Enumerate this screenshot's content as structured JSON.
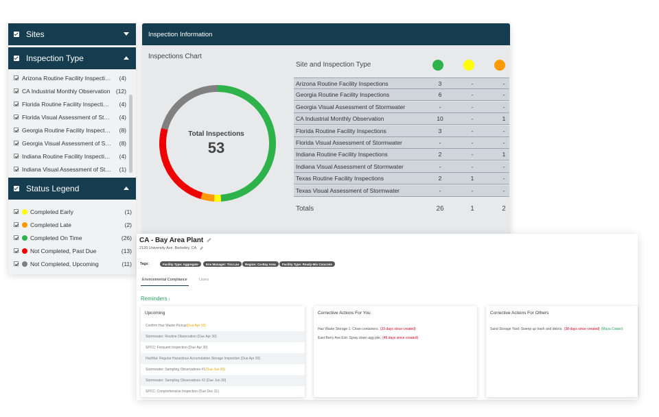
{
  "left_panel": {
    "sites_header": "Sites",
    "inspection_type_header": "Inspection Type",
    "inspection_types": [
      {
        "label": "Arizona Routine Facility Inspections",
        "count": "(4)"
      },
      {
        "label": "CA Industrial Monthly Observation",
        "count": "(12)"
      },
      {
        "label": "Florida Routine Facility Inspections",
        "count": "(4)"
      },
      {
        "label": "Florida Visual Assessment of Stormwater",
        "count": "(4)"
      },
      {
        "label": "Georgia Routine Facility Inspections",
        "count": "(8)"
      },
      {
        "label": "Georgia Visual Assessment of Stormwater",
        "count": "(8)"
      },
      {
        "label": "Indiana Routine Facility Inspections",
        "count": "(4)"
      },
      {
        "label": "Indiana Visual Assessment of Stormwater",
        "count": "(1)"
      }
    ],
    "status_legend_header": "Status Legend",
    "statuses": [
      {
        "label": "Completed Early",
        "count": "(1)",
        "color": "#ffff00"
      },
      {
        "label": "Completed Late",
        "count": "(2)",
        "color": "#ff9900"
      },
      {
        "label": "Completed On Time",
        "count": "(26)",
        "color": "#2db34a"
      },
      {
        "label": "Not Completed, Past Due",
        "count": "(13)",
        "color": "#ee0000"
      },
      {
        "label": "Not Completed, Upcoming",
        "count": "(11)",
        "color": "#808080"
      }
    ]
  },
  "inspection_info": {
    "header": "Inspection Information",
    "chart_title": "Inspections Chart",
    "total_label": "Total Inspections",
    "total_value": "53",
    "table_title": "Site and Inspection Type",
    "status_dot_colors": [
      "#2db34a",
      "#ffff00",
      "#ff9900"
    ],
    "rows": [
      {
        "name": "Arizona Routine Facility Inspections",
        "c1": "3",
        "c2": "-",
        "c3": "-"
      },
      {
        "name": "Georgia Routine Facility Inspections",
        "c1": "6",
        "c2": "-",
        "c3": "-"
      },
      {
        "name": "Georgia Visual Assessment of Stormwater",
        "c1": "-",
        "c2": "-",
        "c3": "-"
      },
      {
        "name": "CA Industrial Monthly Observation",
        "c1": "10",
        "c2": "-",
        "c3": "1"
      },
      {
        "name": "Florida Routine Facility Inspections",
        "c1": "3",
        "c2": "-",
        "c3": "-"
      },
      {
        "name": "Florida Visual Assessment of Stormwater",
        "c1": "-",
        "c2": "-",
        "c3": "-"
      },
      {
        "name": "Indiana Routine Facility Inspections",
        "c1": "2",
        "c2": "-",
        "c3": "1"
      },
      {
        "name": "Indiana Visual Assessment of Stormwater",
        "c1": "-",
        "c2": "-",
        "c3": "-"
      },
      {
        "name": "Texas Routine Facility Inspections",
        "c1": "2",
        "c2": "1",
        "c3": "-"
      },
      {
        "name": "Texas Visual Assessment of Stormwater",
        "c1": "-",
        "c2": "-",
        "c3": "-"
      }
    ],
    "totals_label": "Totals",
    "totals": {
      "c1": "26",
      "c2": "1",
      "c3": "2"
    }
  },
  "chart_data": {
    "type": "pie",
    "title": "Inspections Chart",
    "center_label": "Total Inspections",
    "center_value": 53,
    "slices": [
      {
        "name": "Completed On Time",
        "value": 26,
        "color": "#2db34a"
      },
      {
        "name": "Completed Early",
        "value": 1,
        "color": "#ffff00"
      },
      {
        "name": "Completed Late",
        "value": 2,
        "color": "#ff9900"
      },
      {
        "name": "Not Completed, Past Due",
        "value": 13,
        "color": "#ee0000"
      },
      {
        "name": "Not Completed, Upcoming",
        "value": 11,
        "color": "#808080"
      }
    ]
  },
  "site": {
    "title": "CA - Bay Area Plant",
    "address": "2120 University Ave. Berkeley, CA",
    "tags_label": "Tags:",
    "tags": [
      "Facility Type: Aggregate",
      "Env Manager: Tira Lau",
      "Region: Ca-Bay Area",
      "Facility Type: Ready-Mix Concrete"
    ],
    "tabs": [
      "Environmental Compliance",
      "Users"
    ],
    "reminders_title": "Reminders",
    "reminders_count": "i",
    "upcoming": {
      "title": "Upcoming",
      "items": [
        {
          "text": "Confirm Haz Waste Pickup ",
          "due": "(Due Apr 10)",
          "due_color": "orange"
        },
        {
          "text": "Stormwater: Routine Observation (Due Apr 30)",
          "due": "",
          "due_color": ""
        },
        {
          "text": "SPCC: Frequent Inspection (Due Apr 30)",
          "due": "",
          "due_color": ""
        },
        {
          "text": "HazMat: Regular Hazardous Accumulation Storage Inspection (Due Apr 30)",
          "due": "",
          "due_color": ""
        },
        {
          "text": "Stormwater: Sampling Observations #1 ",
          "due": "(Due Jun 30)",
          "due_color": "orange"
        },
        {
          "text": "Stormwater: Sampling Observations #2 (Due Jun 30)",
          "due": "",
          "due_color": ""
        },
        {
          "text": "SPCC: Comprehensive Inspection (Due Dec 31)",
          "due": "",
          "due_color": ""
        }
      ]
    },
    "corrective_you": {
      "title": "Corrective Actions For You",
      "items": [
        {
          "text": "Haz Waste Storage 1: Close containers.",
          "overdue": "(33 days since created)"
        },
        {
          "text": "East Berry Ave Exit: Spray down agg pile.",
          "overdue": "(46 days since created)"
        }
      ]
    },
    "corrective_others": {
      "title": "Corrective Actions For Others",
      "items": [
        {
          "text": "Sand Storage Yard: Sweep up trash and debris.",
          "overdue": "(38 days since created)",
          "owner": "(Maya Cotato)"
        }
      ]
    }
  }
}
